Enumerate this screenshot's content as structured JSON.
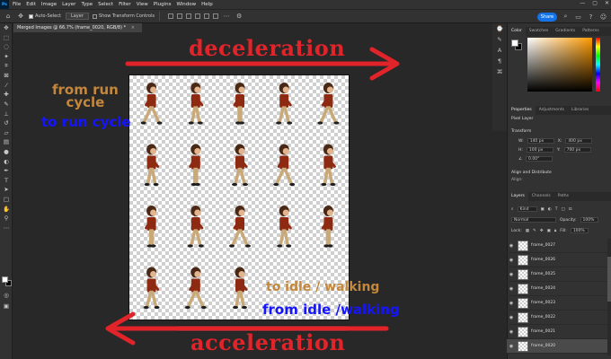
{
  "app": {
    "logo": "Ps"
  },
  "menu": [
    "File",
    "Edit",
    "Image",
    "Layer",
    "Type",
    "Select",
    "Filter",
    "View",
    "Plugins",
    "Window",
    "Help"
  ],
  "options": {
    "auto_select_label": "Auto-Select",
    "target": "Layer",
    "transform_label": "Show Transform Controls",
    "share_label": "Share"
  },
  "document": {
    "tab_title": "Merged Images @ 66.7% (frame_0020, RGB/8) *",
    "close_glyph": "×"
  },
  "annotations": {
    "deceleration": "deceleration",
    "acceleration": "acceleration",
    "from_run_line1": "from run",
    "from_run_line2": "cycle",
    "to_run_cycle": "to run cycle",
    "to_idle": "to idle / walking",
    "from_idle": "from idle /walking"
  },
  "panels": {
    "color_tabs": [
      "Color",
      "Swatches",
      "Gradients",
      "Patterns"
    ],
    "props_tabs": [
      "Properties",
      "Adjustments",
      "Libraries"
    ],
    "pixel_layer_label": "Pixel Layer",
    "transform_title": "Transform",
    "w_label": "W:",
    "w_value": "140 px",
    "x_label": "X:",
    "x_value": "400 px",
    "h_label": "H:",
    "h_value": "100 px",
    "y_label": "Y:",
    "y_value": "700 px",
    "angle_value": "0.00°",
    "align_title": "Align and Distribute",
    "align_sub": "Align:",
    "layers_tabs": [
      "Layers",
      "Channels",
      "Paths"
    ],
    "kind_label": "Kind",
    "blend_mode": "Normal",
    "opacity_label": "Opacity:",
    "opacity_value": "100%",
    "lock_label": "Lock:",
    "fill_label": "Fill:",
    "fill_value": "100%"
  },
  "layers": [
    {
      "name": "frame_0027"
    },
    {
      "name": "frame_0026"
    },
    {
      "name": "frame_0025"
    },
    {
      "name": "frame_0024"
    },
    {
      "name": "frame_0023"
    },
    {
      "name": "frame_0022"
    },
    {
      "name": "frame_0021"
    },
    {
      "name": "frame_0020",
      "selected": true
    }
  ],
  "colors": {
    "annotation_red": "#e0242a",
    "annotation_orange": "#c4873c",
    "annotation_blue": "#1414ff",
    "character_shirt": "#8f2a12",
    "character_pants": "#c9a978",
    "character_hair": "#4a2816",
    "accent": "#1473e6"
  },
  "icons": [
    "move-icon",
    "marquee-icon",
    "lasso-icon",
    "magic-wand-icon",
    "crop-icon",
    "frame-icon",
    "eyedropper-icon",
    "healing-brush-icon",
    "brush-icon",
    "clone-stamp-icon",
    "history-brush-icon",
    "eraser-icon",
    "gradient-icon",
    "blur-icon",
    "dodge-icon",
    "pen-icon",
    "type-icon",
    "path-select-icon",
    "rectangle-icon",
    "hand-icon",
    "zoom-icon",
    "more-tools-icon"
  ]
}
